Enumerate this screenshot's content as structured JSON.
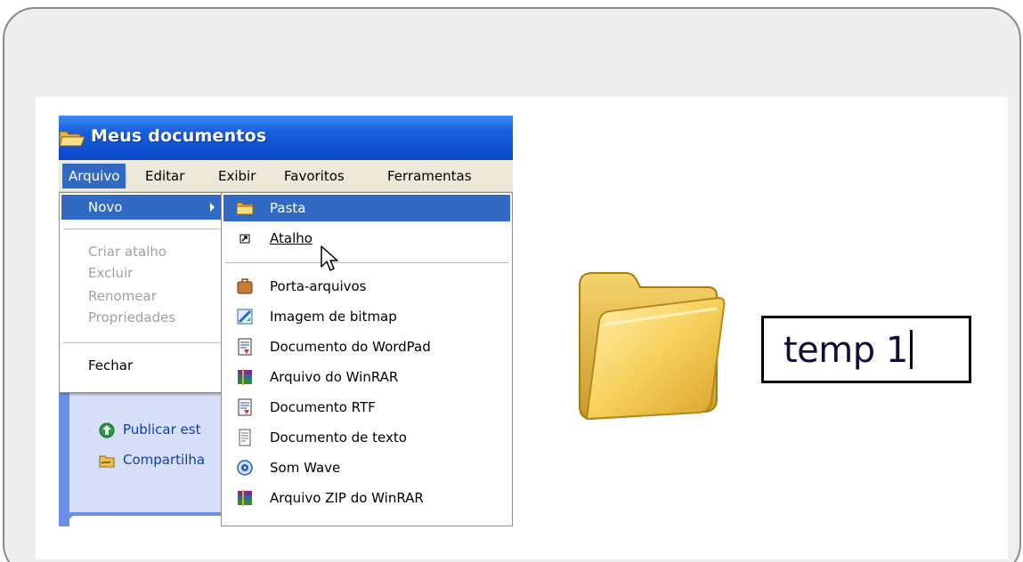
{
  "window": {
    "title": "Meus documentos",
    "title_icon": "folder-open-icon"
  },
  "menubar": {
    "items": [
      "Arquivo",
      "Editar",
      "Exibir",
      "Favoritos",
      "Ferramentas"
    ],
    "active": "Arquivo"
  },
  "file_menu": {
    "items": [
      {
        "label": "Novo",
        "state": "highlighted",
        "has_submenu": true
      },
      {
        "label": "Criar atalho",
        "state": "disabled"
      },
      {
        "label": "Excluir",
        "state": "disabled"
      },
      {
        "label": "Renomear",
        "state": "disabled"
      },
      {
        "label": "Propriedades",
        "state": "disabled"
      },
      {
        "label": "Fechar",
        "state": "enabled"
      }
    ]
  },
  "new_submenu": {
    "items": [
      {
        "label": "Pasta",
        "icon": "folder-icon",
        "state": "highlighted"
      },
      {
        "label": "Atalho",
        "icon": "shortcut-icon"
      },
      {
        "label": "Porta-arquivos",
        "icon": "briefcase-icon"
      },
      {
        "label": "Imagem de bitmap",
        "icon": "bitmap-image-icon"
      },
      {
        "label": "Documento do WordPad",
        "icon": "wordpad-document-icon"
      },
      {
        "label": "Arquivo do WinRAR",
        "icon": "winrar-archive-icon"
      },
      {
        "label": "Documento RTF",
        "icon": "rtf-document-icon"
      },
      {
        "label": "Documento de texto",
        "icon": "text-document-icon"
      },
      {
        "label": "Som Wave",
        "icon": "wave-sound-icon"
      },
      {
        "label": "Arquivo ZIP do WinRAR",
        "icon": "winrar-zip-icon"
      }
    ]
  },
  "task_pane": {
    "items": [
      {
        "label": "Publicar est",
        "icon": "publish-web-icon"
      },
      {
        "label": "Compartilha",
        "icon": "share-folder-icon"
      }
    ]
  },
  "rename": {
    "value": "temp 1",
    "icon": "folder-icon"
  },
  "colors": {
    "title_blue": "#0f52d6",
    "highlight": "#316ac5",
    "menu_bg": "#ece9d8",
    "folder_yellow": "#f3c95a"
  }
}
